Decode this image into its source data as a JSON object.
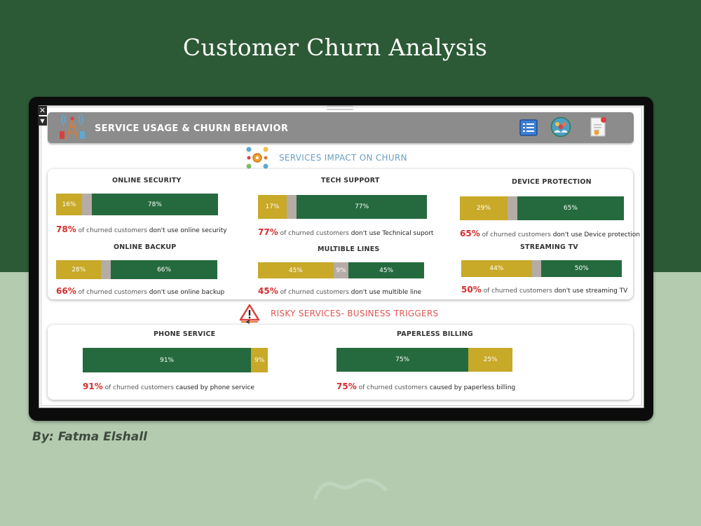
{
  "title": "Customer Churn Analysis",
  "author": "By: Fatma Elshall",
  "dashboard": {
    "header_title": "SERVICE USAGE & CHURN BEHAVIOR",
    "section_impact": "SERVICES IMPACT ON CHURN",
    "section_risky": "RISKY SERVICES- BUSINESS TRIGGERS"
  },
  "colors": {
    "dark_green": "#2d5a36",
    "bar_green": "#256a3e",
    "bar_gold": "#c8a928",
    "bar_gray": "#b5aca6",
    "highlight_red": "#d62d2d",
    "header_gray": "#8c8c8c"
  },
  "icons": {
    "tower": "cell-tower-icon",
    "list": "list-icon",
    "people": "people-icon",
    "document": "document-icon",
    "services": "services-gear-icon",
    "warning": "warning-icon"
  },
  "chart_data": [
    {
      "type": "bar",
      "title": "ONLINE SECURITY",
      "series": [
        {
          "values": [
            16
          ],
          "color": "#c8a928",
          "label": "16%"
        },
        {
          "values": [
            6
          ],
          "color": "#b5aca6",
          "label": ""
        },
        {
          "values": [
            78
          ],
          "color": "#256a3e",
          "label": "78%"
        }
      ],
      "note": {
        "pct": "78%",
        "text_a": " of churned customers ",
        "text_b": "don't use ",
        "keyword": "online security"
      }
    },
    {
      "type": "bar",
      "title": "TECH SUPPORT",
      "series": [
        {
          "values": [
            17
          ],
          "color": "#c8a928",
          "label": "17%"
        },
        {
          "values": [
            6
          ],
          "color": "#b5aca6",
          "label": ""
        },
        {
          "values": [
            77
          ],
          "color": "#256a3e",
          "label": "77%"
        }
      ],
      "note": {
        "pct": "77%",
        "text_a": " of churned customers ",
        "text_b": "don't use ",
        "keyword": "Technical suport"
      }
    },
    {
      "type": "bar",
      "title": "DEVICE PROTECTION",
      "series": [
        {
          "values": [
            29
          ],
          "color": "#c8a928",
          "label": "29%"
        },
        {
          "values": [
            6
          ],
          "color": "#b5aca6",
          "label": ""
        },
        {
          "values": [
            65
          ],
          "color": "#256a3e",
          "label": "65%"
        }
      ],
      "note": {
        "pct": "65%",
        "text_a": " of churned customers ",
        "text_b": "don't use ",
        "keyword": "Device protection"
      }
    },
    {
      "type": "bar",
      "title": "ONLINE BACKUP",
      "series": [
        {
          "values": [
            28
          ],
          "color": "#c8a928",
          "label": "28%"
        },
        {
          "values": [
            6
          ],
          "color": "#b5aca6",
          "label": ""
        },
        {
          "values": [
            66
          ],
          "color": "#256a3e",
          "label": "66%"
        }
      ],
      "note": {
        "pct": "66%",
        "text_a": " of churned customers ",
        "text_b": "don't use ",
        "keyword": "online backup"
      }
    },
    {
      "type": "bar",
      "title": "MULTIBLE LINES",
      "series": [
        {
          "values": [
            45
          ],
          "color": "#c8a928",
          "label": "45%"
        },
        {
          "values": [
            9
          ],
          "color": "#b5aca6",
          "label": "9%"
        },
        {
          "values": [
            45
          ],
          "color": "#256a3e",
          "label": "45%"
        }
      ],
      "note": {
        "pct": "45%",
        "text_a": " of churned customers ",
        "text_b": "don't use ",
        "keyword": "multible line"
      }
    },
    {
      "type": "bar",
      "title": "STREAMING TV",
      "series": [
        {
          "values": [
            44
          ],
          "color": "#c8a928",
          "label": "44%"
        },
        {
          "values": [
            6
          ],
          "color": "#b5aca6",
          "label": ""
        },
        {
          "values": [
            50
          ],
          "color": "#256a3e",
          "label": "50%"
        }
      ],
      "note": {
        "pct": "50%",
        "text_a": " of churned customers ",
        "text_b": "don't use ",
        "keyword": "streaming TV"
      }
    },
    {
      "type": "bar",
      "title": "PHONE SERVICE",
      "series": [
        {
          "values": [
            91
          ],
          "color": "#256a3e",
          "label": "91%"
        },
        {
          "values": [
            9
          ],
          "color": "#c8a928",
          "label": "9%"
        }
      ],
      "note": {
        "pct": "91%",
        "text_a": " of churned customers ",
        "text_b": "caused by ",
        "keyword": "phone service"
      }
    },
    {
      "type": "bar",
      "title": "PAPERLESS BILLING",
      "series": [
        {
          "values": [
            75
          ],
          "color": "#256a3e",
          "label": "75%"
        },
        {
          "values": [
            25
          ],
          "color": "#c8a928",
          "label": "25%"
        }
      ],
      "note": {
        "pct": "75%",
        "text_a": " of churned customers ",
        "text_b": "caused by ",
        "keyword": "paperless billing"
      }
    }
  ]
}
